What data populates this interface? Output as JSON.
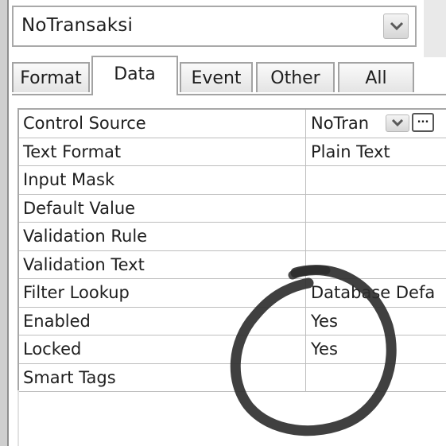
{
  "object_selector": {
    "value": "NoTransaksi",
    "dropdown_icon": "chevron-down-icon"
  },
  "tabs": [
    {
      "label": "Format",
      "active": false
    },
    {
      "label": "Data",
      "active": true
    },
    {
      "label": "Event",
      "active": false
    },
    {
      "label": "Other",
      "active": false
    },
    {
      "label": "All",
      "active": false
    }
  ],
  "properties": [
    {
      "label": "Control Source",
      "value": "NoTran"
    },
    {
      "label": "Text Format",
      "value": "Plain Text"
    },
    {
      "label": "Input Mask",
      "value": ""
    },
    {
      "label": "Default Value",
      "value": ""
    },
    {
      "label": "Validation Rule",
      "value": ""
    },
    {
      "label": "Validation Text",
      "value": ""
    },
    {
      "label": "Filter Lookup",
      "value": "Database Defa"
    },
    {
      "label": "Enabled",
      "value": "Yes"
    },
    {
      "label": "Locked",
      "value": "Yes"
    },
    {
      "label": "Smart Tags",
      "value": ""
    }
  ],
  "control_source_builder_label": "...",
  "annotation": {
    "shape": "hand-drawn-circle",
    "color": "#2b2b2b"
  }
}
